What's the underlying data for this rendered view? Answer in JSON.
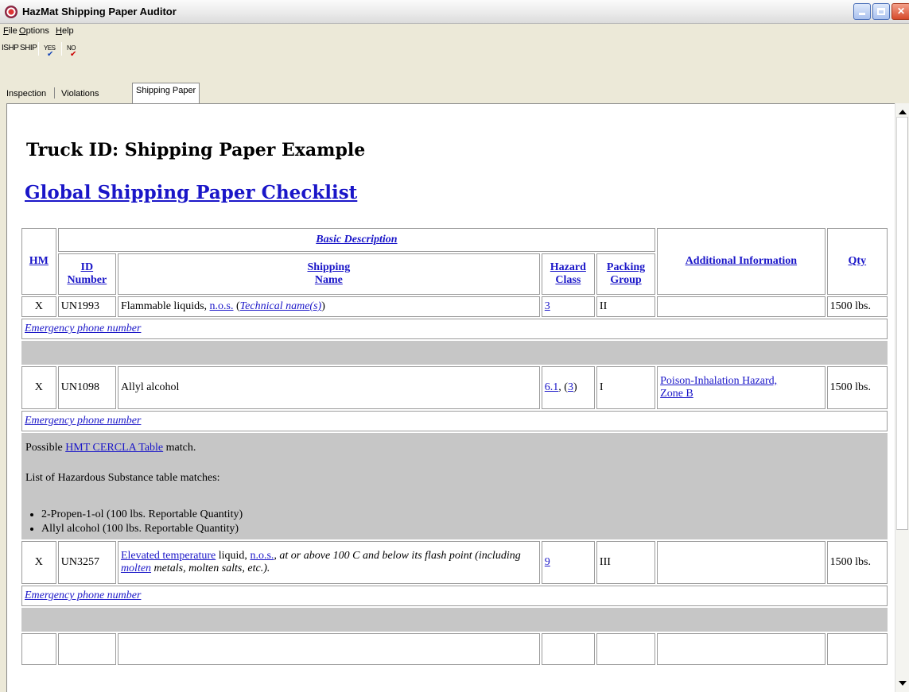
{
  "window": {
    "title": "HazMat Shipping Paper Auditor"
  },
  "menu": {
    "items": [
      {
        "label": "File",
        "accel": "F",
        "rest": "ile"
      },
      {
        "label": "Options",
        "accel": "O",
        "rest": "ptions"
      },
      {
        "label": "Help",
        "accel": "H",
        "rest": "elp"
      }
    ]
  },
  "toolbar": {
    "ishp": "ISHP",
    "ship": "SHIP",
    "yes": "YES",
    "no": "NO"
  },
  "tabs": [
    {
      "label": "Inspection"
    },
    {
      "label": "Violations"
    },
    {
      "label": "Shipping Paper"
    }
  ],
  "page": {
    "heading": "Truck ID: Shipping Paper Example",
    "checklist_link": "Global Shipping Paper Checklist"
  },
  "table": {
    "group_header": "Basic Description",
    "headers": {
      "hm": "HM",
      "id_line1": "ID",
      "id_line2": "Number",
      "shipping_line1": "Shipping",
      "shipping_line2": "Name",
      "hazard_line1": "Hazard",
      "hazard_line2": "Class",
      "packing_line1": "Packing",
      "packing_line2": "Group",
      "additional": "Additional Information",
      "qty": "Qty"
    },
    "emergency_label": "Emergency phone number",
    "rows": [
      {
        "hm": "X",
        "id": "UN1993",
        "name_prefix": "Flammable liquids, ",
        "name_link": "n.o.s.",
        "name_paren_open": " (",
        "name_technical": "Technical name(s)",
        "name_paren_close": ")",
        "hazard": "3",
        "packing": "II",
        "additional": "",
        "qty": "1500 lbs."
      },
      {
        "hm": "X",
        "id": "UN1098",
        "name": "Allyl alcohol",
        "hazard_primary": "6.1",
        "hazard_sep": ", (",
        "hazard_secondary": "3",
        "hazard_close": ")",
        "packing": "I",
        "additional_line1": "Poison-Inhalation Hazard,",
        "additional_line2": "Zone B",
        "qty": "1500 lbs.",
        "notes": {
          "possible_prefix": "Possible ",
          "possible_link": "HMT CERCLA Table",
          "possible_suffix": " match.",
          "list_title": "List of Hazardous Substance table matches:",
          "matches": [
            "2-Propen-1-ol (100 lbs. Reportable Quantity)",
            "Allyl alcohol (100 lbs. Reportable Quantity)"
          ]
        }
      },
      {
        "hm": "X",
        "id": "UN3257",
        "name_link1": "Elevated temperature",
        "name_text1": " liquid, ",
        "name_link2": "n.o.s.",
        "name_italic1": ", at or above 100 C and below its flash point (including ",
        "name_link3": "molten",
        "name_italic2": " metals, molten salts, etc.).",
        "hazard": "9",
        "packing": "III",
        "additional": "",
        "qty": "1500 lbs."
      }
    ]
  },
  "colors": {
    "link": "#1a16c8",
    "gray_row": "#c6c6c6",
    "window_bg": "#ece9d8"
  }
}
